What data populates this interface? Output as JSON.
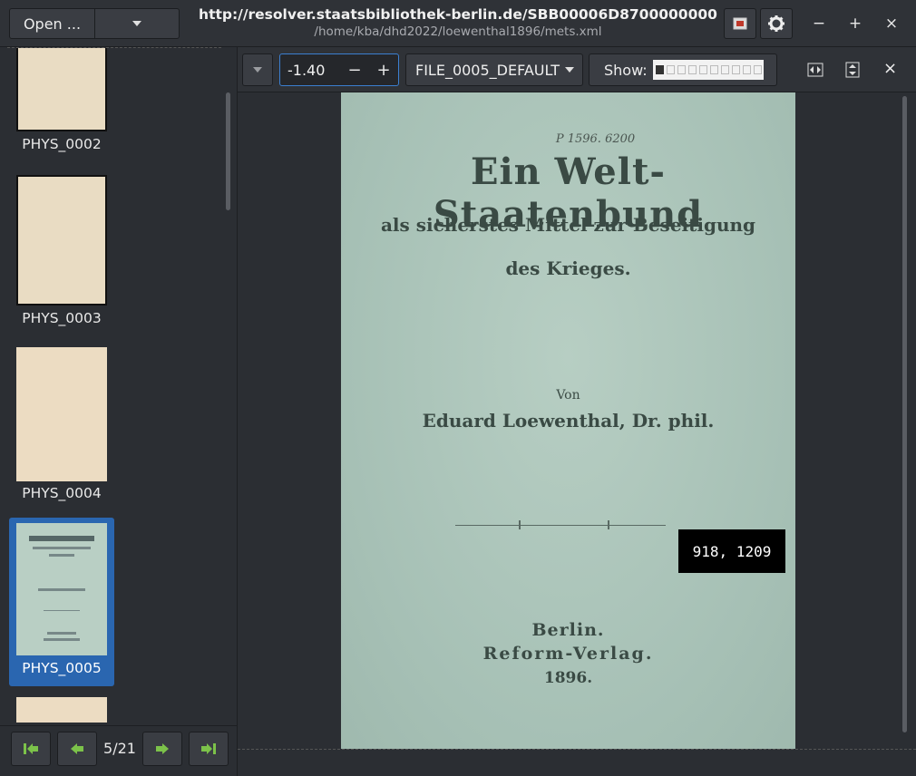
{
  "header": {
    "open_label": "Open ...",
    "title": "http://resolver.staatsbibliothek-berlin.de/SBB00006D8700000000",
    "subtitle": "/home/kba/dhd2022/loewenthal1896/mets.xml"
  },
  "window": {
    "minimize": "−",
    "maximize": "+",
    "close": "×"
  },
  "sidebar": {
    "thumbnails": [
      {
        "label": "PHYS_0002"
      },
      {
        "label": "PHYS_0003"
      },
      {
        "label": "PHYS_0004"
      },
      {
        "label": "PHYS_0005",
        "selected": true
      }
    ],
    "page_counter": "5/21"
  },
  "toolbar": {
    "zoom_value": "-1.40",
    "zoom_minus": "−",
    "zoom_plus": "+",
    "file_group": "FILE_0005_DEFAULT",
    "show_label": "Show:",
    "close": "×"
  },
  "page": {
    "shelfmark": "P 1596. 6200",
    "title_line1": "Ein Welt-Staatenbund",
    "title_line2": "als sicherstes Mittel zur Beseitigung",
    "title_line3": "des Krieges.",
    "by": "Von",
    "author": "Eduard Loewenthal, Dr. phil.",
    "place": "Berlin.",
    "publisher": "Reform-Verlag.",
    "year": "1896."
  },
  "cursor_coords": "918, 1209",
  "colors": {
    "accent": "#2a66b0",
    "page_bg": "#a9c3b8"
  }
}
